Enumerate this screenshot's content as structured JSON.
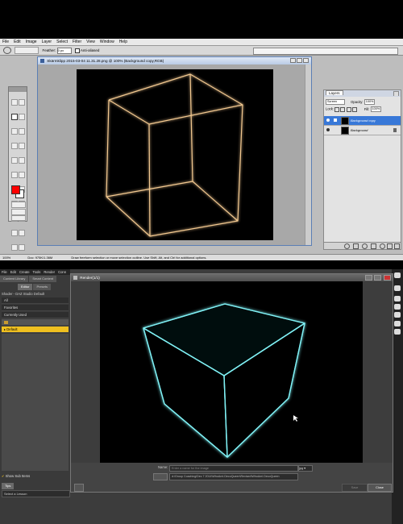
{
  "photoshop": {
    "menu": [
      "File",
      "Edit",
      "Image",
      "Layer",
      "Select",
      "Filter",
      "View",
      "Window",
      "Help"
    ],
    "options": {
      "feather_label": "Feather:",
      "feather_value": "0 px",
      "antialias_label": "Anti-aliased"
    },
    "document_title": "Skärmklipp 2015-03-04 11.31.28.png @ 100% (Background copy,RGB)",
    "status": {
      "zoom": "100%",
      "doc": "Doc: 975K/1.36M",
      "hint": "Draw freeform selection or move selection outline. Use Shift, Alt, and Ctrl for additional options."
    },
    "layers_panel": {
      "tab": "Layers",
      "blend_mode": "Screen",
      "opacity_label": "Opacity:",
      "opacity_value": "100%",
      "lock_label": "Lock:",
      "fill_label": "Fill:",
      "fill_value": "100%",
      "layers": [
        {
          "name": "Background copy",
          "selected": true
        },
        {
          "name": "Background",
          "selected": false
        }
      ]
    },
    "accent_color": "#3878d8",
    "foreground_color": "#ff0000",
    "wire_color": "#f2c890"
  },
  "daz": {
    "menu": [
      "File",
      "Edit",
      "Create",
      "Tools",
      "Render",
      "Conn"
    ],
    "left_tabs_top": [
      "Content Library",
      "Smart Content"
    ],
    "left_tabs_mid": [
      "Editor",
      "Presets"
    ],
    "shader_label": "Shader - DAZ Studio Default",
    "list_items": [
      "All",
      "Favorites",
      "Currently Used"
    ],
    "tree_items": [
      "Default"
    ],
    "show_sub_items": "Show Sub Items",
    "tips_tab": "Tips",
    "lesson_select": "Select a Lesson",
    "render_window": {
      "title": "Render(1/1)",
      "name_label": "Name:",
      "name_placeholder": "Enter a name for the image",
      "format": "jpg",
      "path": "d:\\Group Coaching\\Dec 7 2014\\WhoAmI.DecoQueen\\Revised\\WhoAmI.DecoQueen",
      "save_label": "Save",
      "close_label": "Close"
    },
    "wire_color": "#7ff0f4"
  }
}
